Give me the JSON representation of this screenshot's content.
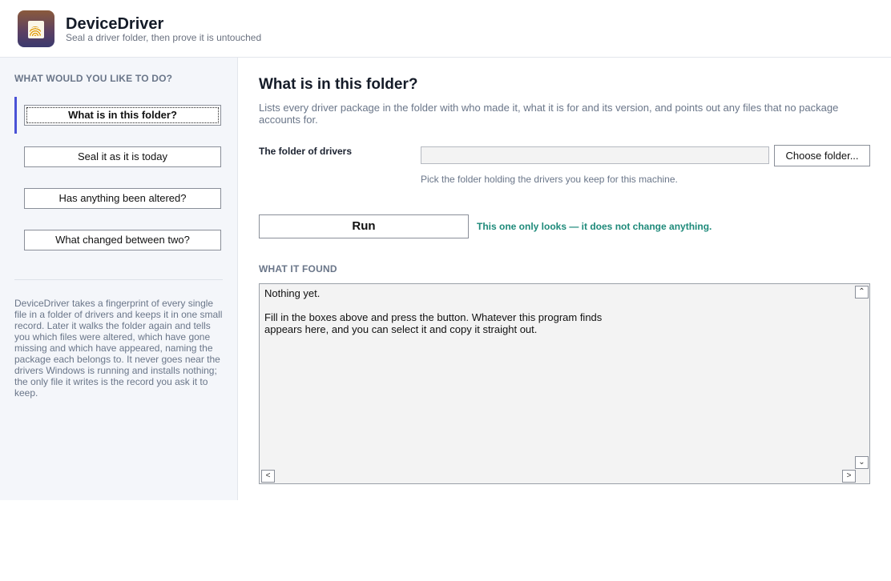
{
  "app": {
    "title": "DeviceDriver",
    "subtitle": "Seal a driver folder, then prove it is untouched",
    "icon": "folder-fingerprint-icon"
  },
  "sidebar": {
    "heading": "WHAT WOULD YOU LIKE TO DO?",
    "items": [
      {
        "label": "What is in this folder?",
        "active": true
      },
      {
        "label": "Seal it as it is today",
        "active": false
      },
      {
        "label": "Has anything been altered?",
        "active": false
      },
      {
        "label": "What changed between two?",
        "active": false
      }
    ],
    "about": "DeviceDriver takes a fingerprint of every single file in a folder of drivers and keeps it in one small record. Later it walks the folder again and tells you which files were altered, which have gone missing and which have appeared, naming the package each belongs to. It never goes near the drivers Windows is running and installs nothing; the only file it writes is the record you ask it to keep."
  },
  "main": {
    "title": "What is in this folder?",
    "description": "Lists every driver package in the folder with who made it, what it is for and its version, and points out any files that no package accounts for.",
    "folder_label": "The folder of drivers",
    "folder_value": "",
    "choose_label": "Choose folder...",
    "folder_hint": "Pick the folder holding the drivers you keep for this machine.",
    "run_label": "Run",
    "run_note": "This one only looks — it does not change anything.",
    "found_heading": "WHAT IT FOUND",
    "output": "Nothing yet.\n\nFill in the boxes above and press the button. Whatever this program finds\nappears here, and you can select it and copy it straight out."
  },
  "colors": {
    "accent": "#4a52d6",
    "note_green": "#1e8a7a",
    "muted": "#6a7689",
    "sidebar_bg": "#f4f6fa"
  }
}
